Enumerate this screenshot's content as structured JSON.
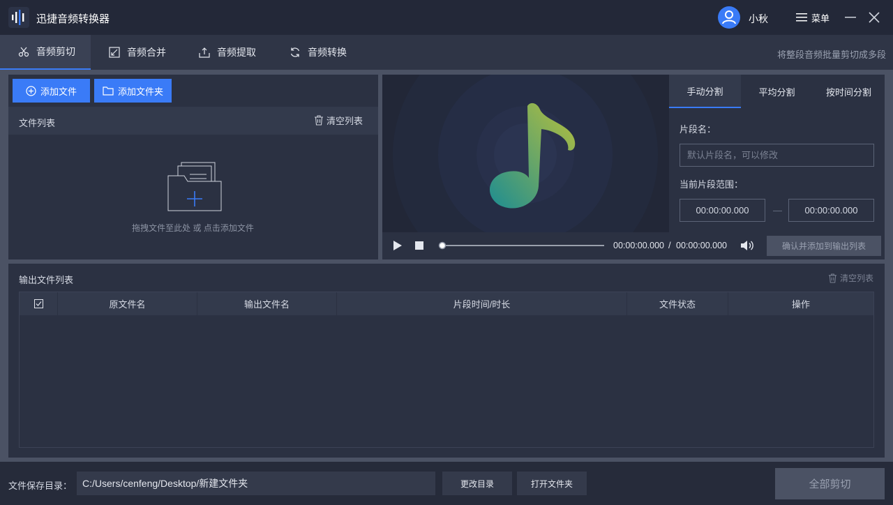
{
  "app": {
    "title": "迅捷音频转换器",
    "username": "小秋",
    "menu_label": "菜单"
  },
  "tabs": [
    {
      "label": "音频剪切",
      "icon": "scissors-icon",
      "active": true
    },
    {
      "label": "音频合并",
      "icon": "merge-icon"
    },
    {
      "label": "音频提取",
      "icon": "extract-icon"
    },
    {
      "label": "音频转换",
      "icon": "refresh-icon"
    }
  ],
  "tab_hint": "将整段音频批量剪切成多段",
  "file_panel": {
    "add_file": "添加文件",
    "add_folder": "添加文件夹",
    "list_title": "文件列表",
    "clear_list": "清空列表",
    "drop_hint": "拖拽文件至此处 或 点击添加文件"
  },
  "split_tabs": [
    "手动分割",
    "平均分割",
    "按时间分割"
  ],
  "manual": {
    "segment_name_label": "片段名：",
    "segment_name_placeholder": "默认片段名，可以修改",
    "range_label": "当前片段范围：",
    "start_time": "00:00:00.000",
    "end_time": "00:00:00.000",
    "range_separator": "—"
  },
  "player": {
    "current_time": "00:00:00.000",
    "separator": "/",
    "total_time": "00:00:00.000",
    "confirm_btn": "确认并添加到输出列表"
  },
  "output": {
    "title": "输出文件列表",
    "clear_list": "清空列表",
    "columns": [
      "原文件名",
      "输出文件名",
      "片段时间/时长",
      "文件状态",
      "操作"
    ]
  },
  "bottom": {
    "save_label": "文件保存目录：",
    "save_path": "C:/Users/cenfeng/Desktop/新建文件夹",
    "change_dir": "更改目录",
    "open_folder": "打开文件夹",
    "cut_all": "全部剪切"
  },
  "colors": {
    "accent": "#3a7bf7",
    "bg": "#2b3142",
    "titlebar": "#232838"
  }
}
